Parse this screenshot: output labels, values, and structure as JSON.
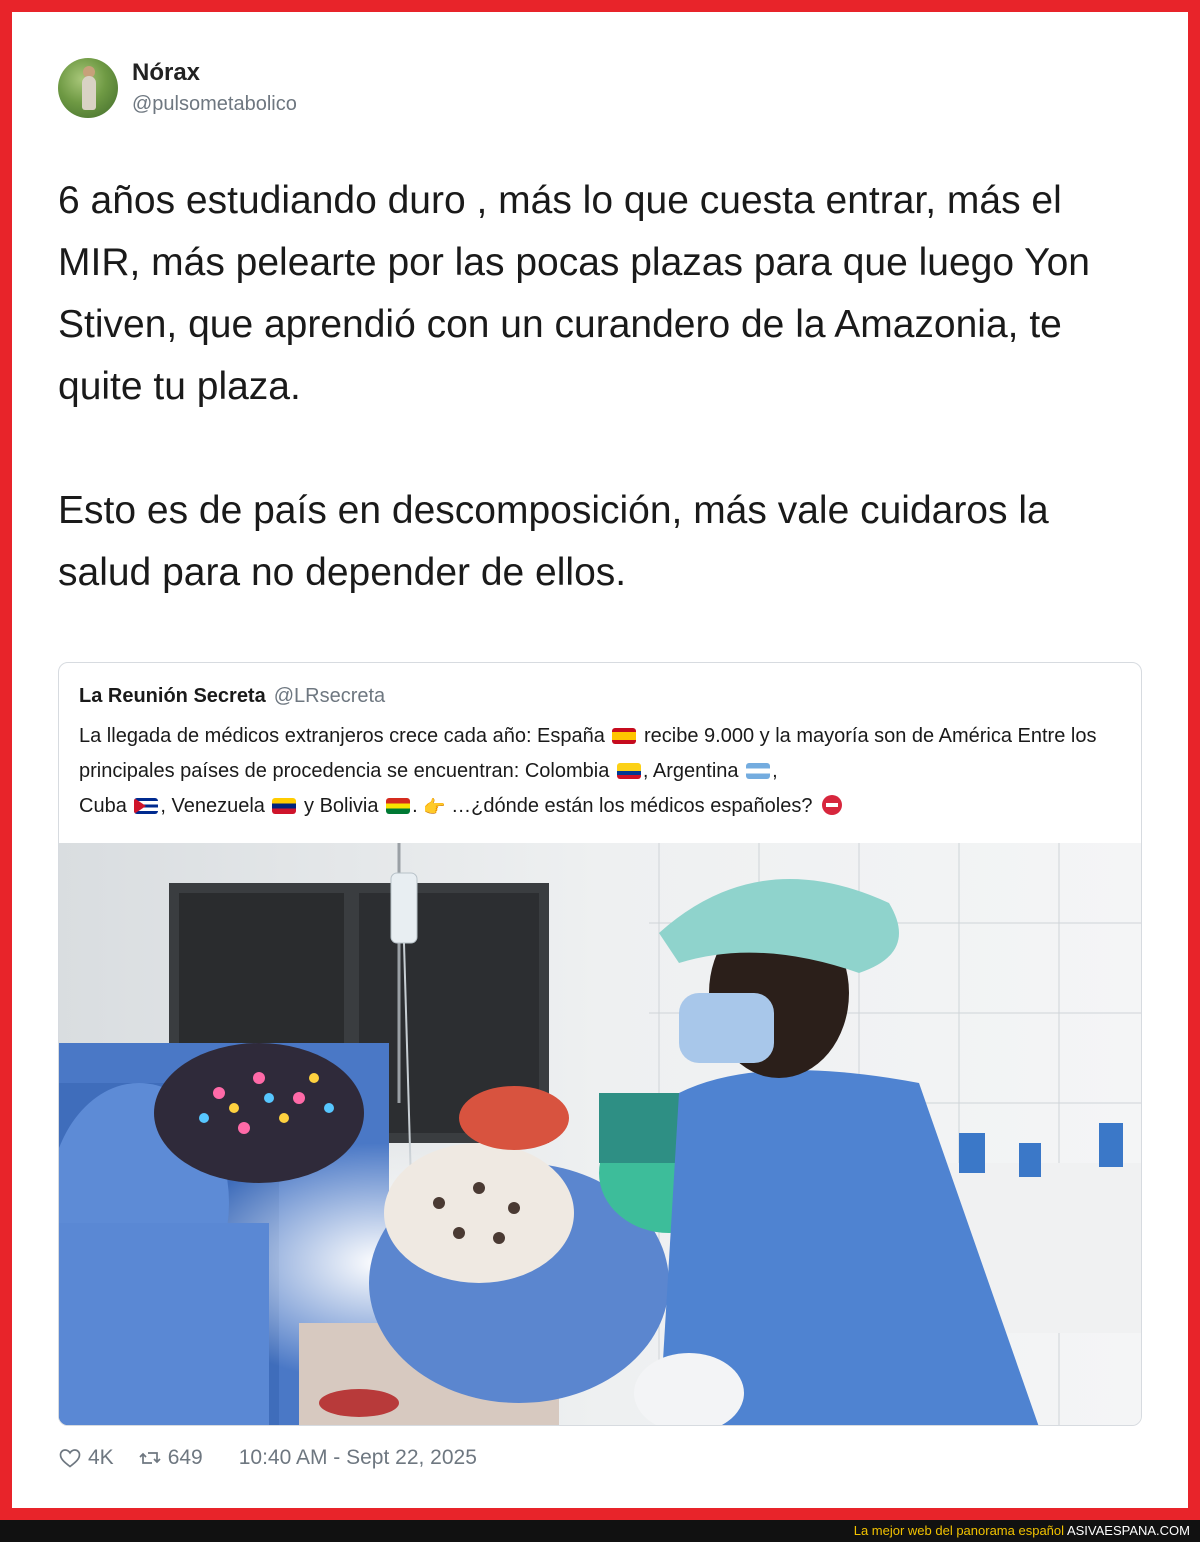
{
  "tweet": {
    "author_name": "Nórax",
    "author_handle": "@pulsometabolico",
    "paragraph_1": "6 años estudiando duro , más lo que cuesta entrar, más el MIR, más pelearte por las pocas plazas para que luego Yon Stiven, que aprendió con un curandero de la Amazonia, te quite tu plaza.",
    "paragraph_2": "Esto es de país en descomposición, más vale cuidaros la salud para no depender de ellos."
  },
  "quote": {
    "author_name": "La Reunión Secreta",
    "author_handle": "@LRsecreta",
    "text_parts": {
      "p1": "La llegada de médicos extranjeros crece cada año: España",
      "p2": " recibe 9.000 y la mayoría son de América Entre los principales países de procedencia se encuentran: Colombia",
      "p3": ", Argentina",
      "p4": ",",
      "p5": "Cuba",
      "p6": ", Venezuela",
      "p7": " y Bolivia",
      "p8": ".",
      "p9": " …¿dónde están los médicos españoles?"
    }
  },
  "meta": {
    "likes": "4K",
    "retweets": "649",
    "timestamp": "10:40 AM - Sept 22, 2025"
  },
  "footer": {
    "tagline": "La mejor web del panorama español",
    "brand": "ASIVAESPANA.COM"
  },
  "icons": {
    "like": "heart-outline-icon",
    "retweet": "retweet-icon",
    "pointing_hand": "👉"
  },
  "colors": {
    "frame_red": "#e8242a",
    "footer_yellow": "#f2c200",
    "muted_text": "#6e7780"
  }
}
